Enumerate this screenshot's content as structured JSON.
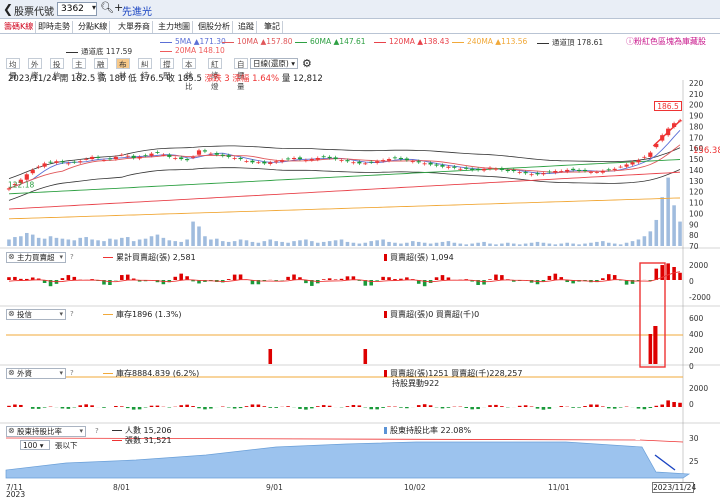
{
  "topbar": {
    "back_icon": "chevron-left-icon",
    "label": "股票代號",
    "code": "3362",
    "stock_name": "先進光"
  },
  "tabs": [
    {
      "label": "籌碼K線",
      "active": true
    },
    {
      "label": "即時走勢",
      "active": false
    },
    {
      "label": "分點K線",
      "active": false
    },
    {
      "label": "大單券商",
      "active": false
    },
    {
      "label": "主力地圖",
      "active": false
    },
    {
      "label": "個股分析",
      "active": false
    },
    {
      "label": "追蹤",
      "active": false
    },
    {
      "label": "筆記",
      "active": false
    }
  ],
  "hint_right": "ⓘ粉紅色區塊為庫藏股",
  "ma_legend": [
    {
      "label": "5MA ▲171.30",
      "color": "#5b6fd6"
    },
    {
      "label": "10MA ▲157.80",
      "color": "#e0575a"
    },
    {
      "label": "60MA ▲147.61",
      "color": "#2ea043"
    },
    {
      "label": "120MA ▲138.43",
      "color": "#e8424a"
    },
    {
      "label": "240MA ▲113.56",
      "color": "#f1a93a"
    },
    {
      "label": "通道頂 178.61",
      "color": "#333333"
    }
  ],
  "ma_legend2": [
    {
      "label": "通道底 117.59",
      "color": "#333333"
    },
    {
      "label": "20MA 148.10",
      "color": "#ef5b5b"
    }
  ],
  "toolbar": [
    {
      "label": "均價",
      "on": false
    },
    {
      "label": "外資",
      "on": false
    },
    {
      "label": "投信",
      "on": false
    },
    {
      "label": "主力",
      "on": false
    },
    {
      "label": "融資",
      "on": false
    },
    {
      "label": "布林",
      "on": true
    },
    {
      "label": "糾結",
      "on": false
    },
    {
      "label": "撐壓",
      "on": false
    },
    {
      "label": "本益比",
      "on": false
    },
    {
      "label": "紅綠燈",
      "on": false
    },
    {
      "label": "自價量",
      "on": false
    }
  ],
  "range_select": "日線(還原)",
  "ohlc": {
    "date": "2023/11/24",
    "open": "開 182.5",
    "high": "高 186",
    "low": "低 176.5",
    "close": "收 185.5",
    "change": "漲跌 3",
    "pct": "漲幅 1.64%",
    "volume": "量 12,812"
  },
  "price_badge": "186.5",
  "price_tag": "156.38",
  "low_label": "122.18",
  "panels": {
    "p1": {
      "select": "主力買賣超",
      "line1": "累計買賣超(張) 2,581",
      "line2": "買賣超(張) 1,094"
    },
    "p2": {
      "select": "投信",
      "line1": "庫存1896 (1.3%)",
      "line2": "買賣超(張)0 買賣超(千)0"
    },
    "p3": {
      "select": "外資",
      "line1": "庫存8884.839 (6.2%)",
      "line2": "買賣超(張)1251 買賣超(千)228,257",
      "line3": "持股異動922"
    },
    "p4": {
      "select": "股東持股比率",
      "line1": "人數 15,206",
      "line2": "張數 31,521",
      "line3": "股東持股比率 22.08%"
    }
  },
  "p4_controls": {
    "count": "100",
    "mode": "張以下"
  },
  "axis": {
    "price_ticks": [
      "220",
      "210",
      "200",
      "190",
      "180",
      "170",
      "160",
      "150",
      "140",
      "130",
      "120",
      "110",
      "100",
      "90",
      "80",
      "70"
    ],
    "p1_ticks": [
      "2000",
      "0",
      "-2000"
    ],
    "p2_ticks": [
      "600",
      "400",
      "200",
      "0"
    ],
    "p3_ticks": [
      "2000",
      "0"
    ],
    "p4_ticks": [
      "30",
      "25"
    ],
    "x_ticks": [
      "7/11",
      "8/01",
      "9/01",
      "10/02",
      "11/01"
    ],
    "year": "2023"
  },
  "date_badge": "2023/11/24",
  "chart_data": {
    "type": "candlestick",
    "title": "",
    "x_range": [
      "2023/07/11",
      "2023/11/24"
    ],
    "ylim": [
      70,
      220
    ],
    "last": {
      "open": 182.5,
      "high": 186,
      "low": 176.5,
      "close": 185.5,
      "volume": 12812
    },
    "close_series": [
      123,
      127,
      131,
      136,
      140,
      143,
      146,
      147,
      148,
      147,
      146,
      147,
      148,
      150,
      152,
      151,
      149,
      150,
      152,
      154,
      153,
      151,
      152,
      153,
      155,
      156,
      154,
      152,
      151,
      150,
      149,
      152,
      158,
      157,
      155,
      154,
      153,
      152,
      151,
      150,
      148,
      147,
      147,
      146,
      147,
      148,
      149,
      150,
      151,
      150,
      149,
      150,
      151,
      152,
      151,
      150,
      149,
      148,
      147,
      146,
      146,
      147,
      148,
      149,
      150,
      151,
      150,
      149,
      148,
      147,
      146,
      145,
      144,
      143,
      143,
      142,
      141,
      141,
      140,
      140,
      141,
      142,
      141,
      140,
      139,
      139,
      138,
      137,
      136,
      136,
      137,
      138,
      139,
      139,
      140,
      140,
      139,
      139,
      138,
      138,
      139,
      140,
      141,
      143,
      145,
      147,
      149,
      152,
      156,
      164,
      172,
      178,
      183,
      185.5
    ],
    "volume_series": [
      40,
      55,
      60,
      80,
      70,
      50,
      45,
      60,
      50,
      45,
      40,
      35,
      50,
      55,
      40,
      35,
      30,
      45,
      40,
      50,
      55,
      30,
      40,
      45,
      60,
      70,
      50,
      35,
      30,
      25,
      40,
      150,
      120,
      60,
      40,
      45,
      30,
      25,
      30,
      40,
      35,
      25,
      20,
      30,
      40,
      30,
      25,
      20,
      30,
      35,
      40,
      30,
      20,
      25,
      30,
      35,
      40,
      25,
      20,
      15,
      20,
      30,
      35,
      40,
      25,
      20,
      15,
      20,
      30,
      25,
      20,
      15,
      20,
      25,
      30,
      20,
      15,
      10,
      15,
      20,
      25,
      15,
      10,
      15,
      20,
      15,
      10,
      15,
      20,
      25,
      20,
      15,
      10,
      15,
      20,
      15,
      10,
      15,
      20,
      25,
      30,
      20,
      15,
      10,
      20,
      30,
      40,
      60,
      90,
      160,
      300,
      420,
      250,
      150
    ]
  }
}
